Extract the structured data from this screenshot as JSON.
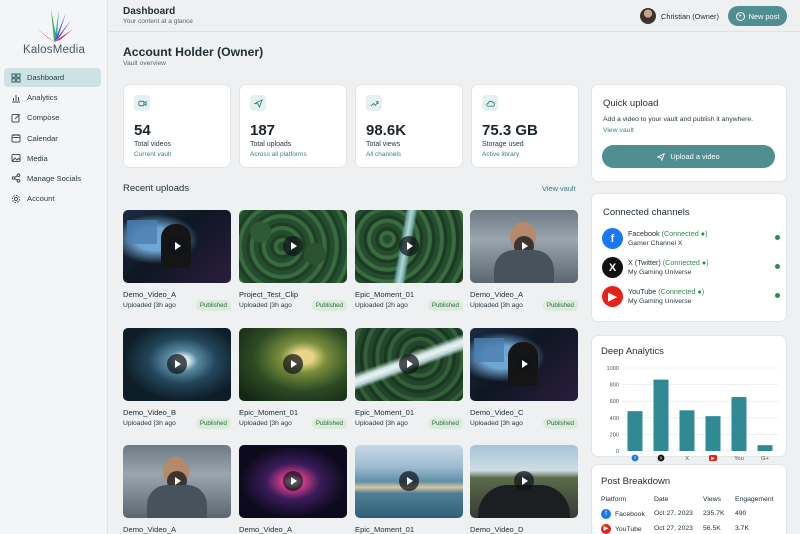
{
  "brand": {
    "name": "KalosMedia"
  },
  "sidebar": {
    "items": [
      {
        "label": "Dashboard",
        "icon": "grid-icon",
        "active": true
      },
      {
        "label": "Analytics",
        "icon": "bar-chart-icon"
      },
      {
        "label": "Compose",
        "icon": "pencil-icon"
      },
      {
        "label": "Calendar",
        "icon": "calendar-icon"
      },
      {
        "label": "Media",
        "icon": "image-icon"
      },
      {
        "label": "Manage Socials",
        "icon": "share-icon"
      },
      {
        "label": "Account",
        "icon": "gear-icon"
      }
    ]
  },
  "header": {
    "title": "Dashboard",
    "subtitle": "Your content at a glance",
    "user_name": "Christian (Owner)",
    "new_post_label": "New post"
  },
  "main": {
    "title": "Account Holder (Owner)",
    "subtitle": "Vault overview",
    "stats": [
      {
        "value": "54",
        "label": "Total videos",
        "link": "Current vault",
        "icon": "video-icon"
      },
      {
        "value": "187",
        "label": "Total uploads",
        "link": "Across all platforms",
        "icon": "send-icon"
      },
      {
        "value": "98.6K",
        "label": "Total views",
        "link": "All channels",
        "icon": "trend-up-icon"
      },
      {
        "value": "75.3 GB",
        "label": "Storage used",
        "link": "Active library",
        "icon": "cloud-icon"
      }
    ],
    "recent_title": "Recent uploads",
    "view_vault_label": "View vault",
    "videos": [
      {
        "title": "Demo_Video_A",
        "meta": "Uploaded [3h ago",
        "status": "Published",
        "scene": "gamer"
      },
      {
        "title": "Project_Test_Clip",
        "meta": "Uploaded [3h ago",
        "status": "Published",
        "scene": "forest"
      },
      {
        "title": "Epic_Moment_01",
        "meta": "Uploaded [2h ago",
        "status": "Published",
        "scene": "river"
      },
      {
        "title": "Demo_Video_A",
        "meta": "Uploaded [3h ago",
        "status": "Published",
        "scene": "man"
      },
      {
        "title": "Demo_Video_B",
        "meta": "Uploaded [3h ago",
        "status": "Published",
        "scene": "tunnel"
      },
      {
        "title": "Epic_Moment_01",
        "meta": "Uploaded [3h ago",
        "status": "Published",
        "scene": "glowforest"
      },
      {
        "title": "Epic_Moment_01",
        "meta": "Uploaded [3h ago",
        "status": "Published",
        "scene": "falls"
      },
      {
        "title": "Demo_Video_C",
        "meta": "Uploaded [3h ago",
        "status": "Published",
        "scene": "gamer"
      },
      {
        "title": "Demo_Video_A",
        "meta": "",
        "status": "",
        "scene": "man"
      },
      {
        "title": "Demo_Video_A",
        "meta": "",
        "status": "",
        "scene": "neon"
      },
      {
        "title": "Epic_Moment_01",
        "meta": "",
        "status": "",
        "scene": "coast"
      },
      {
        "title": "Demo_Video_D",
        "meta": "",
        "status": "",
        "scene": "car"
      }
    ]
  },
  "quick_upload": {
    "title": "Quick upload",
    "description": "Add a video to your vault and publish it anywhere.",
    "link": "View vault",
    "button_label": "Upload a video"
  },
  "connected": {
    "title": "Connected channels",
    "channels": [
      {
        "platform": "Facebook",
        "status": "(Connected ●)",
        "account": "Gamer Channel X",
        "color": "#1877f2",
        "glyph": "f"
      },
      {
        "platform": "X (Twitter)",
        "status": "(Connected ●)",
        "account": "My Gaming Universe",
        "color": "#111111",
        "glyph": "X"
      },
      {
        "platform": "YouTube",
        "status": "(Connected ●)",
        "account": "My Gaming Universe",
        "color": "#e62117",
        "glyph": "▶"
      }
    ]
  },
  "analytics": {
    "title": "Deep Analytics"
  },
  "chart_data": {
    "type": "bar",
    "categories": [
      "facebook-icon",
      "x-icon",
      "X",
      "youtube-icon",
      "You",
      "G+"
    ],
    "values": [
      480,
      860,
      490,
      420,
      650,
      70
    ],
    "ylim": [
      0,
      1000
    ],
    "yticks": [
      "1000",
      "800",
      "600",
      "400",
      "200",
      "0"
    ],
    "grid": true,
    "color": "#2f8a94"
  },
  "breakdown": {
    "title": "Post Breakdown",
    "columns": [
      "Platform",
      "Date",
      "Views",
      "Engagement"
    ],
    "rows": [
      {
        "platform": "Facebook",
        "date": "Oct 27, 2023",
        "views": "235.7K",
        "engagement": "490",
        "color": "#1877f2",
        "glyph": "f"
      },
      {
        "platform": "YouTube",
        "date": "Oct 27, 2023",
        "views": "56.5K",
        "engagement": "3.7K",
        "color": "#e62117",
        "glyph": "▶"
      }
    ]
  }
}
